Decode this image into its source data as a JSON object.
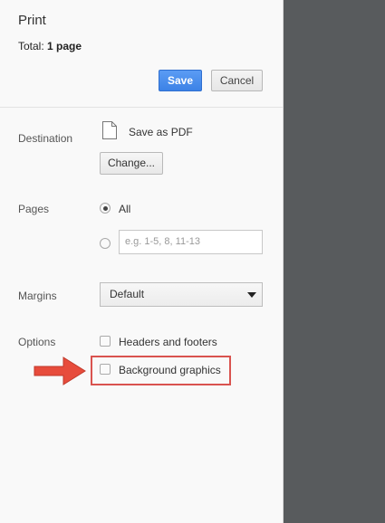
{
  "header": {
    "title": "Print",
    "total_label": "Total:",
    "total_value": "1 page",
    "save_label": "Save",
    "cancel_label": "Cancel"
  },
  "destination": {
    "label": "Destination",
    "name": "Save as PDF",
    "change_label": "Change...",
    "icon": "file-icon"
  },
  "pages": {
    "label": "Pages",
    "all_label": "All",
    "all_selected": true,
    "custom_placeholder": "e.g. 1-5, 8, 11-13"
  },
  "margins": {
    "label": "Margins",
    "selected": "Default"
  },
  "options": {
    "label": "Options",
    "headers_footers_label": "Headers and footers",
    "headers_footers_checked": false,
    "background_graphics_label": "Background graphics",
    "background_graphics_checked": false
  },
  "annotation": {
    "arrow_color": "#e74c3c",
    "box_color": "#d9534f"
  },
  "colors": {
    "accent": "#4285f4",
    "preview_bg": "#585b5d"
  }
}
